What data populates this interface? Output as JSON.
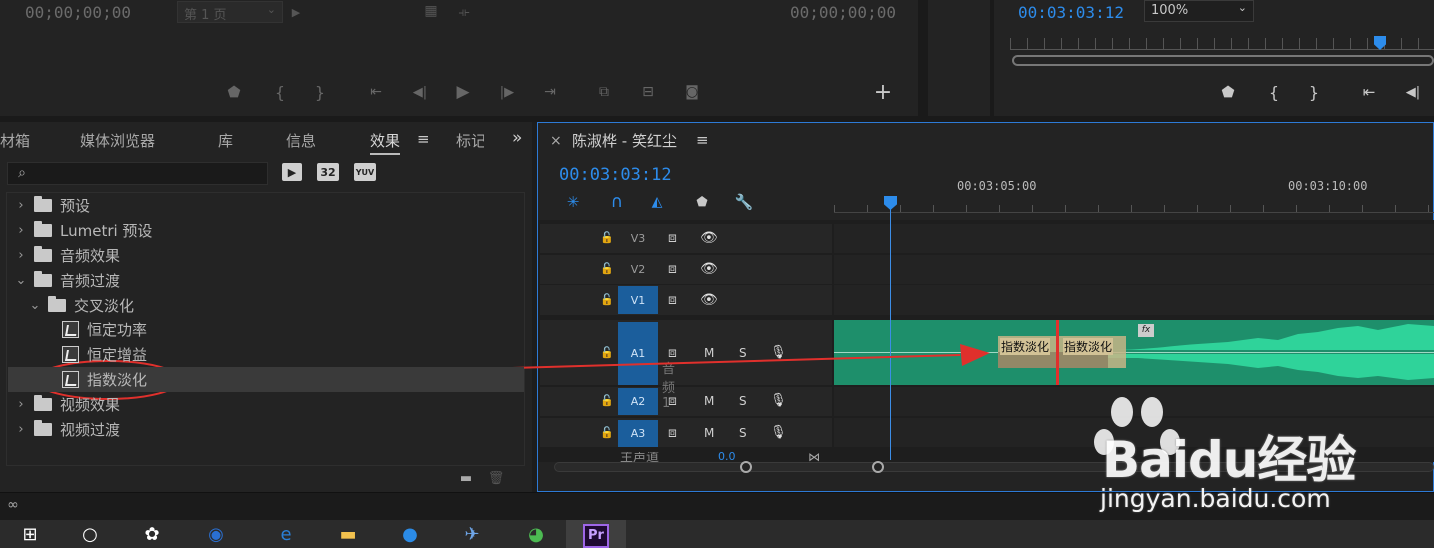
{
  "source_monitor": {
    "timecode_left": "00;00;00;00",
    "page_select": "第 1 页",
    "timecode_right": "00;00;00;00"
  },
  "program_monitor": {
    "timecode": "00:03:03:12",
    "zoom": "100%"
  },
  "effects_panel": {
    "tabs": [
      {
        "label": "材箱"
      },
      {
        "label": "媒体浏览器"
      },
      {
        "label": "库"
      },
      {
        "label": "信息"
      },
      {
        "label": "效果"
      },
      {
        "label": "标记"
      }
    ],
    "menu_glyph": "≡",
    "overflow_glyph": "»",
    "search": {
      "value": "",
      "placeholder": ""
    },
    "buttons": [
      "32",
      "YUV"
    ],
    "tree": [
      {
        "label": "预设",
        "type": "preset-folder",
        "indent": 0,
        "expanded": false
      },
      {
        "label": "Lumetri 预设",
        "type": "preset-folder",
        "indent": 0,
        "expanded": false
      },
      {
        "label": "音频效果",
        "type": "folder",
        "indent": 0,
        "expanded": false
      },
      {
        "label": "音频过渡",
        "type": "folder",
        "indent": 0,
        "expanded": true
      },
      {
        "label": "交叉淡化",
        "type": "folder",
        "indent": 1,
        "expanded": true
      },
      {
        "label": "恒定功率",
        "type": "effect",
        "indent": 2
      },
      {
        "label": "恒定增益",
        "type": "effect",
        "indent": 2
      },
      {
        "label": "指数淡化",
        "type": "effect",
        "indent": 2,
        "selected": true
      },
      {
        "label": "视频效果",
        "type": "folder",
        "indent": 0,
        "expanded": false
      },
      {
        "label": "视频过渡",
        "type": "folder",
        "indent": 0,
        "expanded": false
      }
    ]
  },
  "timeline": {
    "title": "陈淑桦 - 笑红尘",
    "close_glyph": "×",
    "menu_glyph": "≡",
    "timecode": "00:03:03:12",
    "ruler_labels": [
      "00:03:05:00",
      "00:03:10:00"
    ],
    "tracks": [
      {
        "name": "V3",
        "kind": "video"
      },
      {
        "name": "V2",
        "kind": "video"
      },
      {
        "name": "V1",
        "kind": "video",
        "targeted": true
      },
      {
        "name": "A1",
        "kind": "audio",
        "targeted": true,
        "label": "音频 1"
      },
      {
        "name": "A2",
        "kind": "audio",
        "targeted": true
      },
      {
        "name": "A3",
        "kind": "audio",
        "targeted": true
      }
    ],
    "master_track": "主声道",
    "master_value": "0.0",
    "track_buttons": {
      "mute": "M",
      "solo": "S"
    },
    "transitions": [
      "指数淡化",
      "指数淡化"
    ],
    "fx_badge": "fx"
  },
  "watermark": {
    "brand": "Baidu经验",
    "url": "jingyan.baidu.com"
  },
  "taskbar": {
    "apps": [
      "windows-start",
      "search",
      "app-flower",
      "sogou-browser",
      "edge",
      "file-explorer",
      "sogou",
      "app-bird",
      "app-green",
      "premiere"
    ],
    "premiere_label": "Pr"
  },
  "colors": {
    "accent_blue": "#2d8ceb",
    "audio_clip": "#1e8f6b",
    "waveform": "#2fd39a",
    "annotation_red": "#e0302c",
    "track_target": "#1b5e9c"
  }
}
